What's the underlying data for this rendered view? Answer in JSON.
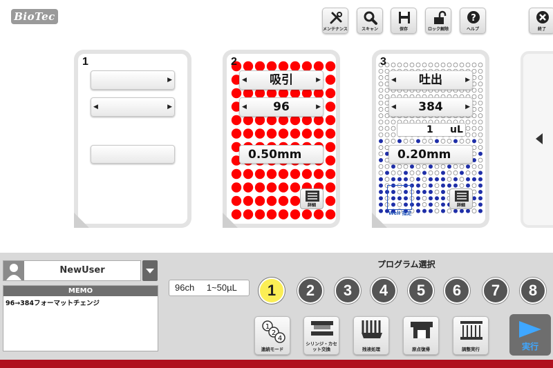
{
  "logo": "BioTec",
  "toolbar": {
    "maintenance": "メンテナンス",
    "scan": "スキャン",
    "save": "保存",
    "unlock": "ロック解除",
    "help": "ヘルプ",
    "exit": "終了"
  },
  "panels": [
    {
      "number": "1"
    },
    {
      "number": "2",
      "action": "吸引",
      "plate": "96",
      "height": "0.50mm",
      "detail": "詳細"
    },
    {
      "number": "3",
      "action": "吐出",
      "plate": "384",
      "volume": "1",
      "unit": "uL",
      "height": "0.20mm",
      "detail": "詳細",
      "well_select": "Well 指定"
    }
  ],
  "user": {
    "name": "NewUser"
  },
  "memo": {
    "header": "MEMO",
    "text": "96→384フォーマットチェンジ"
  },
  "spec": {
    "channels": "96ch",
    "range": "1~50µL"
  },
  "program": {
    "title": "プログラム選択",
    "numbers": [
      "1",
      "2",
      "3",
      "4",
      "5",
      "6",
      "7",
      "8"
    ],
    "selected": "1"
  },
  "actions": {
    "continuous": "連続モード",
    "syringe": "シリンジ・カセット交換",
    "residual": "残液処理",
    "home": "原点復帰",
    "adjust": "調整実行",
    "run": "実行"
  },
  "colors": {
    "accent_red": "#b0101e",
    "dot_red": "#ff0000",
    "dot_blue": "#1f2fa8",
    "run_blue": "#3fa7ff",
    "selected_yellow": "#fbee55"
  }
}
